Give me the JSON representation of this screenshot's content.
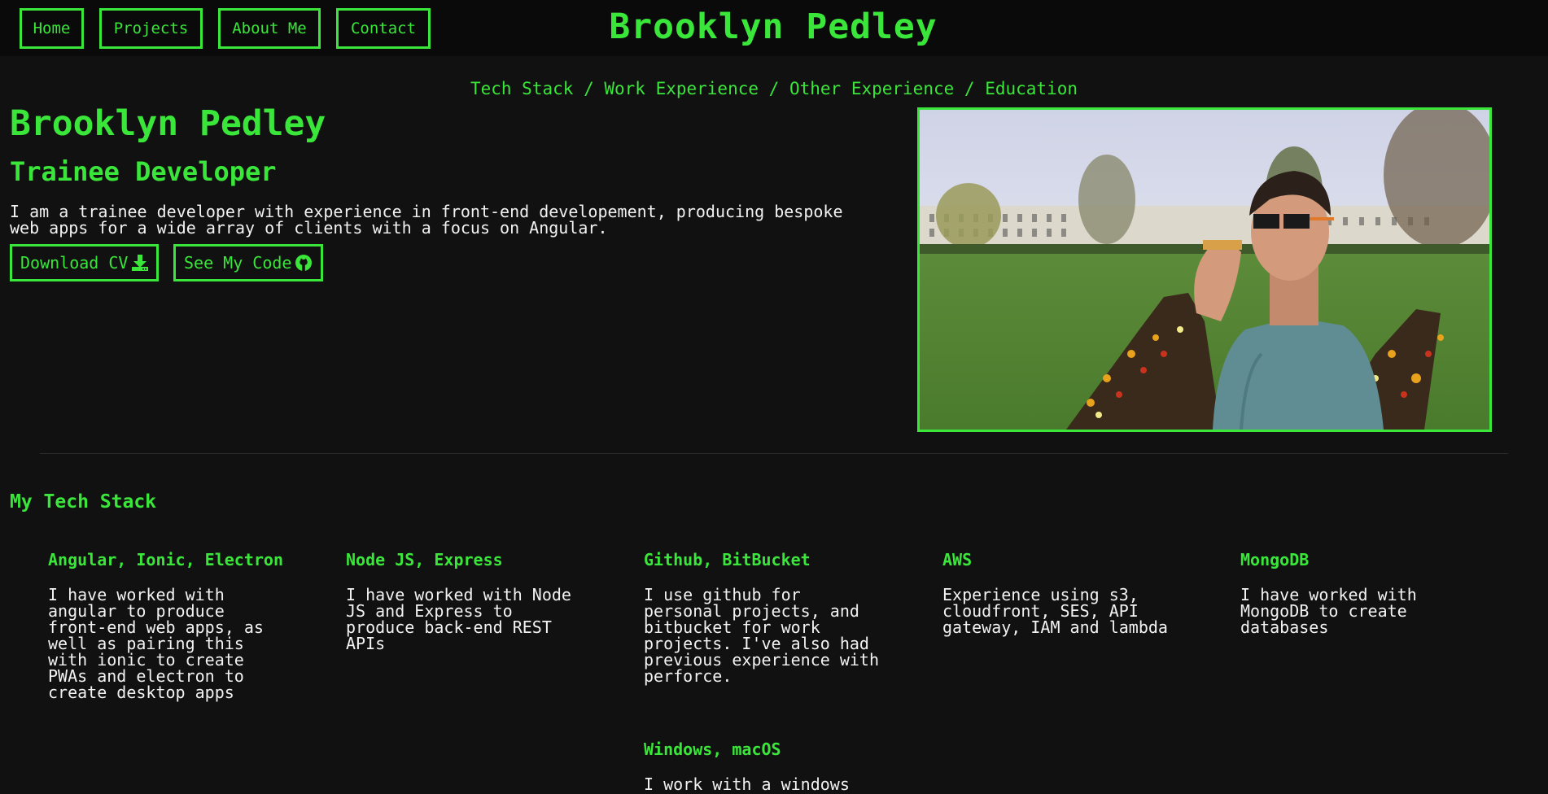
{
  "nav": {
    "items": [
      {
        "label": "Home"
      },
      {
        "label": "Projects"
      },
      {
        "label": "About Me"
      },
      {
        "label": "Contact"
      }
    ],
    "site_title": "Brooklyn Pedley"
  },
  "breadcrumb": {
    "items": [
      "Tech Stack",
      "Work Experience",
      "Other Experience",
      "Education"
    ],
    "separator": "/"
  },
  "hero": {
    "name": "Brooklyn Pedley",
    "role": "Trainee Developer",
    "description": "I am a trainee developer with experience in front-end developement, producing bespoke web apps for a wide array of clients with a focus on Angular.",
    "buttons": [
      {
        "label": "Download CV",
        "icon": "download-icon"
      },
      {
        "label": "See My Code",
        "icon": "github-icon"
      }
    ]
  },
  "tech_stack": {
    "title": "My Tech Stack",
    "items": [
      {
        "name": "Angular, Ionic, Electron",
        "description": "I have worked with angular to produce front-end web apps, as well as pairing this with ionic to create PWAs and electron to create desktop apps"
      },
      {
        "name": "Node JS, Express",
        "description": "I have worked with Node JS and Express to produce back-end REST APIs"
      },
      {
        "name": "Github, BitBucket",
        "description": "I use github for personal projects, and bitbucket for work projects. I've also had previous experience with perforce."
      },
      {
        "name": "AWS",
        "description": "Experience using s3, cloudfront, SES, API gateway, IAM and lambda"
      },
      {
        "name": "MongoDB",
        "description": "I have worked with MongoDB to create databases"
      },
      {
        "name": "Windows, macOS",
        "description": "I work with a windows"
      }
    ]
  },
  "colors": {
    "accent": "#39e639",
    "background": "#111111",
    "topbar": "#0a0a0a",
    "text": "#f2f2f2"
  }
}
